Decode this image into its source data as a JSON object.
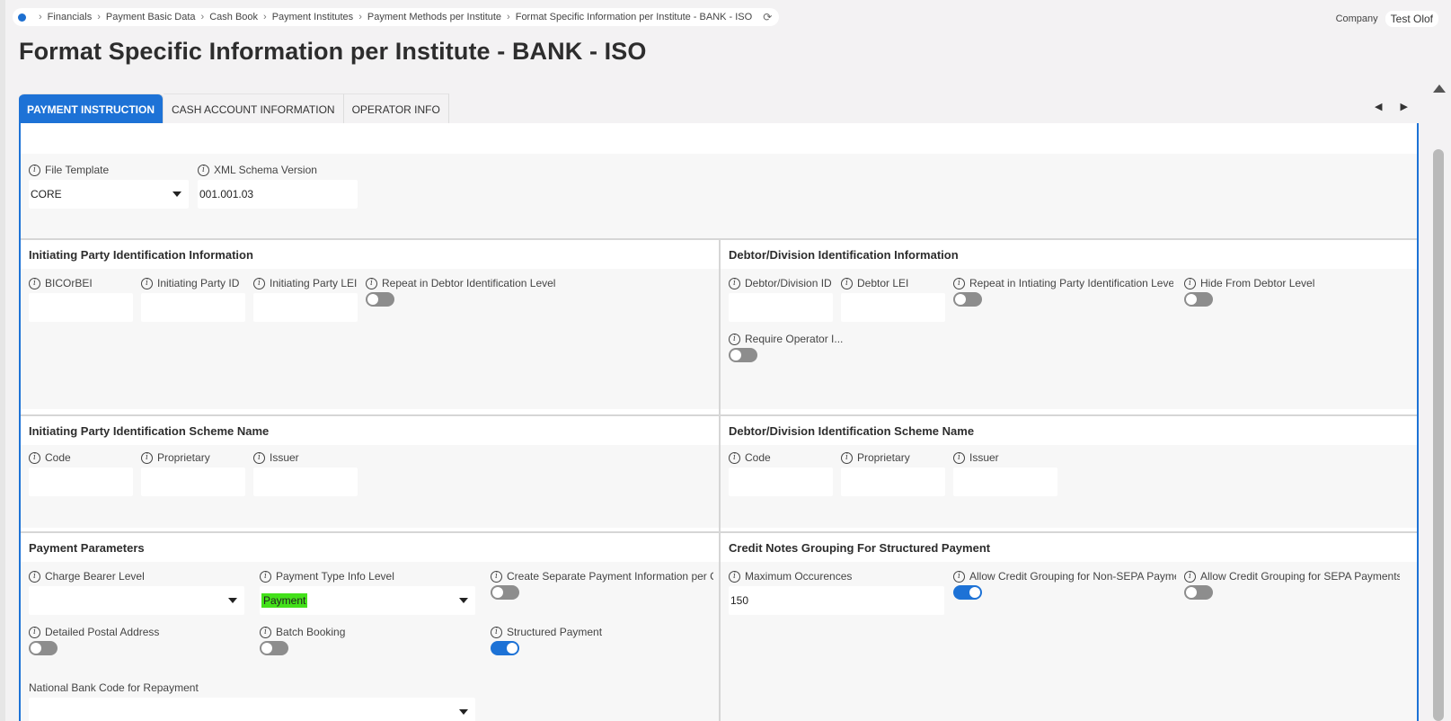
{
  "breadcrumb": [
    "Financials",
    "Payment Basic Data",
    "Cash Book",
    "Payment Institutes",
    "Payment Methods per Institute",
    "Format Specific Information per Institute - BANK - ISO"
  ],
  "company": {
    "label": "Company",
    "value": "Test Olof"
  },
  "title": "Format Specific Information per Institute - BANK - ISO",
  "tabs": [
    "PAYMENT INSTRUCTION",
    "CASH ACCOUNT INFORMATION",
    "OPERATOR INFO"
  ],
  "top": {
    "file_template": {
      "label": "File Template",
      "value": "CORE"
    },
    "xml_schema": {
      "label": "XML Schema Version",
      "value": "001.001.03"
    }
  },
  "initiating": {
    "title": "Initiating Party Identification Information",
    "bic": "BICOrBEI",
    "party_id": "Initiating Party ID",
    "party_lei": "Initiating Party LEI",
    "repeat": "Repeat in Debtor Identification Level"
  },
  "debtor": {
    "title": "Debtor/Division Identification Information",
    "div_id": "Debtor/Division ID",
    "lei": "Debtor LEI",
    "repeat": "Repeat in Intiating Party Identification Level",
    "hide": "Hide From Debtor Level",
    "require": "Require Operator I..."
  },
  "init_scheme": {
    "title": "Initiating Party Identification Scheme Name",
    "code": "Code",
    "proprietary": "Proprietary",
    "issuer": "Issuer"
  },
  "debtor_scheme": {
    "title": "Debtor/Division Identification Scheme Name",
    "code": "Code",
    "proprietary": "Proprietary",
    "issuer": "Issuer"
  },
  "payment_params": {
    "title": "Payment Parameters",
    "charge_bearer": "Charge Bearer Level",
    "payment_type": "Payment Type Info Level",
    "payment_type_value": "Payment",
    "separate": "Create Separate Payment Information per C...",
    "postal": "Detailed Postal Address",
    "batch": "Batch Booking",
    "structured": "Structured Payment",
    "national": "National Bank Code for Repayment"
  },
  "credit_notes": {
    "title": "Credit Notes Grouping For Structured Payment",
    "max_occ": "Maximum Occurences",
    "max_occ_value": "150",
    "non_sepa": "Allow Credit Grouping for Non-SEPA Payme...",
    "sepa": "Allow Credit Grouping for SEPA Payments"
  },
  "colors": {
    "accent": "#1d72d6",
    "highlight": "#43e11a"
  }
}
